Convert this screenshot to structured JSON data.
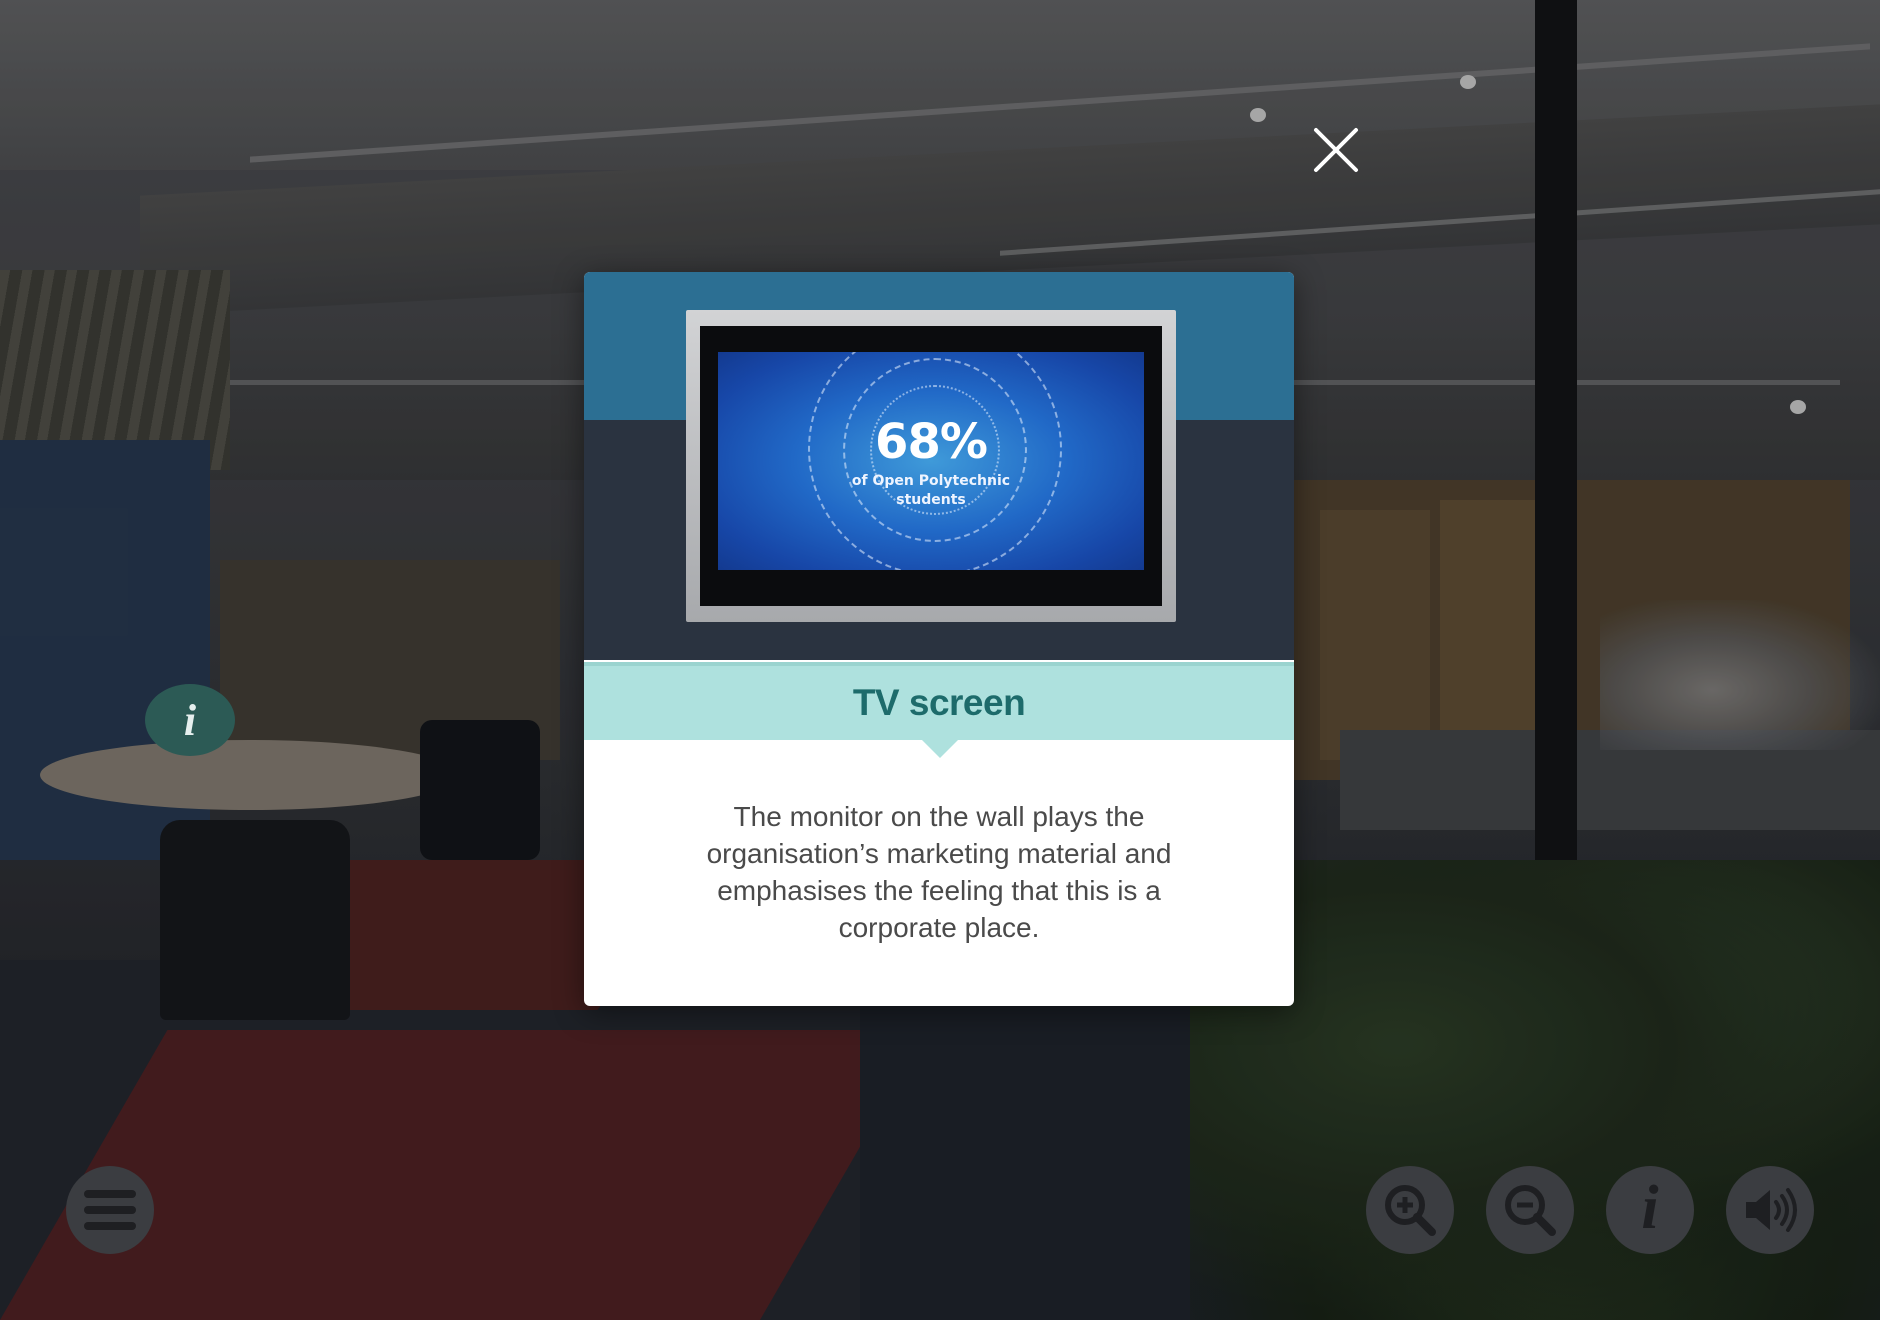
{
  "popup": {
    "title": "TV screen",
    "description": "The monitor on the wall plays the organisation’s marketing material and emphasises the feeling that this is a corporate place."
  },
  "tv_screen": {
    "headline": "68%",
    "subline1": "of Open Polytechnic",
    "subline2": "students"
  },
  "hotspot": {
    "icon": "info-icon"
  },
  "toolbar": {
    "menu_icon": "hamburger-menu-icon",
    "zoom_in_icon": "zoom-in-icon",
    "zoom_out_icon": "zoom-out-icon",
    "info_icon": "info-icon",
    "sound_icon": "speaker-icon",
    "info_glyph": "i"
  },
  "colors": {
    "title_bar": "#aee1de",
    "title_text": "#1d6b6b",
    "button_bg": "#3b3d41"
  }
}
